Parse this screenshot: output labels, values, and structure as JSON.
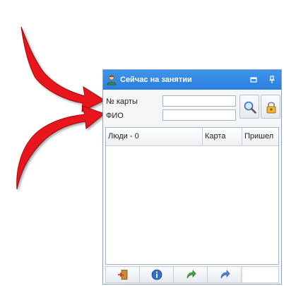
{
  "panel": {
    "title": "Сейчас на занятии",
    "icons": {
      "title": "user-icon",
      "restore": "window-restore-icon",
      "pin": "pin-icon"
    }
  },
  "form": {
    "card_label": "№ карты",
    "card_value": "",
    "name_label": "ФИО",
    "name_value": "",
    "search_icon": "magnifier-icon",
    "lock_icon": "padlock-icon"
  },
  "grid": {
    "columns": [
      "Люди - 0",
      "Карта",
      "Пришел"
    ],
    "rows": []
  },
  "bottom_toolbar": {
    "icons": [
      "exit-door-icon",
      "info-icon",
      "redo-green-icon",
      "redo-blue-icon"
    ]
  },
  "annotations": {
    "arrow_color": "#e8131c",
    "icon": "red-arrow-icon"
  }
}
